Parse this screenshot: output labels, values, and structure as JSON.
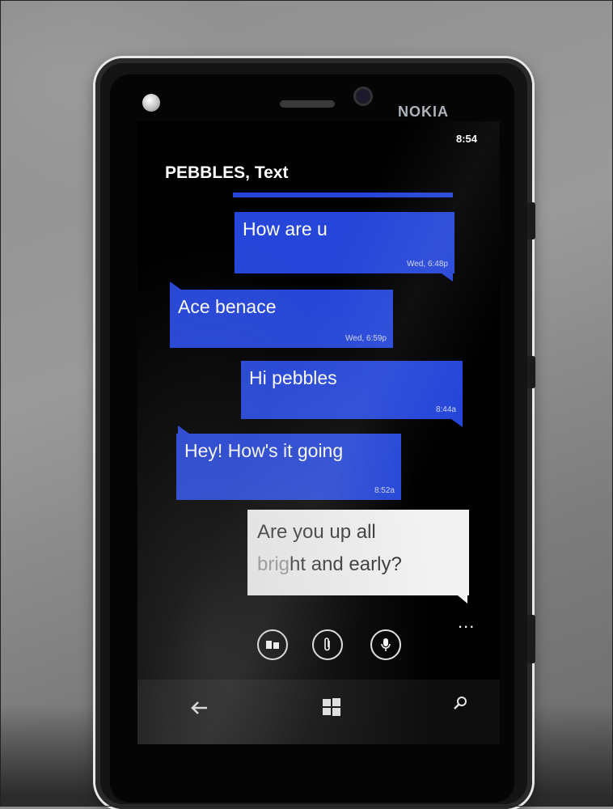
{
  "phone": {
    "brand": "NOKIA",
    "status_time": "8:54"
  },
  "conversation": {
    "title": "PEBBLES, Text",
    "messages": [
      {
        "text": "How are u",
        "time": "Wed, 6:48p",
        "direction": "outgoing"
      },
      {
        "text": "Ace benace",
        "time": "Wed, 6:59p",
        "direction": "incoming"
      },
      {
        "text": "Hi pebbles",
        "time": "8:44a",
        "direction": "outgoing"
      },
      {
        "text": "Hey! How's it going",
        "time": "8:52a",
        "direction": "incoming"
      }
    ]
  },
  "compose": {
    "line1": "Are you up all",
    "line2_faded": "brig",
    "line2_rest": "ht and early?"
  },
  "appbar": {
    "more_label": "...",
    "buttons": [
      "switch-sim-icon",
      "attach-icon",
      "microphone-icon"
    ]
  },
  "navbar": {
    "icons": [
      "back-arrow-icon",
      "windows-start-icon",
      "search-icon"
    ]
  },
  "colors": {
    "bubble": "#2546d8",
    "compose_bg": "#f2f2f2",
    "screen_bg": "#000000"
  }
}
